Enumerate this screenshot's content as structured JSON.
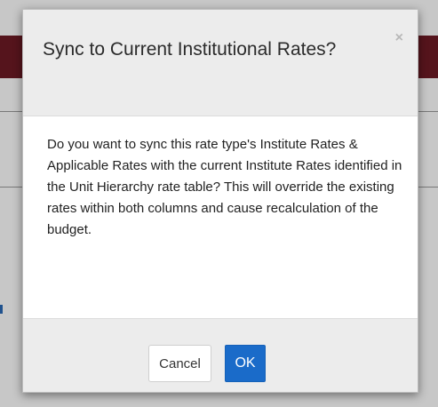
{
  "dialog": {
    "title": "Sync to Current Institutional Rates?",
    "close_icon": "×",
    "message": "Do you want to sync this rate type's Institute Rates & Applicable Rates with the current Institute Rates identified in the Unit Hierarchy rate table? This will override the existing rates within both columns and cause recalculation of the budget.",
    "cancel_label": "Cancel",
    "ok_label": "OK"
  },
  "colors": {
    "header_brand": "#6e1a24",
    "primary_button": "#1a6bc9",
    "dialog_header_bg": "#ececec"
  }
}
